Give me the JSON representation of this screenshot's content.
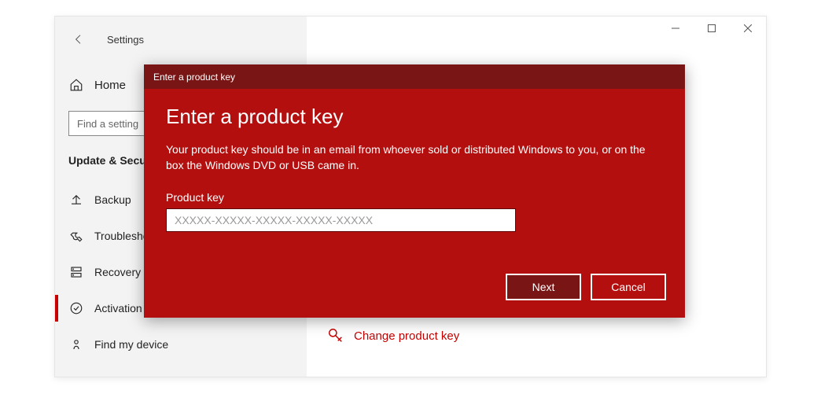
{
  "window": {
    "settings_label": "Settings"
  },
  "sidebar": {
    "home_label": "Home",
    "search_placeholder": "Find a setting",
    "section_heading": "Update & Security",
    "items": [
      {
        "label": "Backup"
      },
      {
        "label": "Troubleshoot"
      },
      {
        "label": "Recovery"
      },
      {
        "label": "Activation"
      },
      {
        "label": "Find my device"
      }
    ]
  },
  "main": {
    "change_key_label": "Change product key"
  },
  "modal": {
    "titlebar": "Enter a product key",
    "heading": "Enter a product key",
    "description": "Your product key should be in an email from whoever sold or distributed Windows to you, or on the box the Windows DVD or USB came in.",
    "field_label": "Product key",
    "placeholder": "XXXXX-XXXXX-XXXXX-XXXXX-XXXXX",
    "next_label": "Next",
    "cancel_label": "Cancel"
  }
}
